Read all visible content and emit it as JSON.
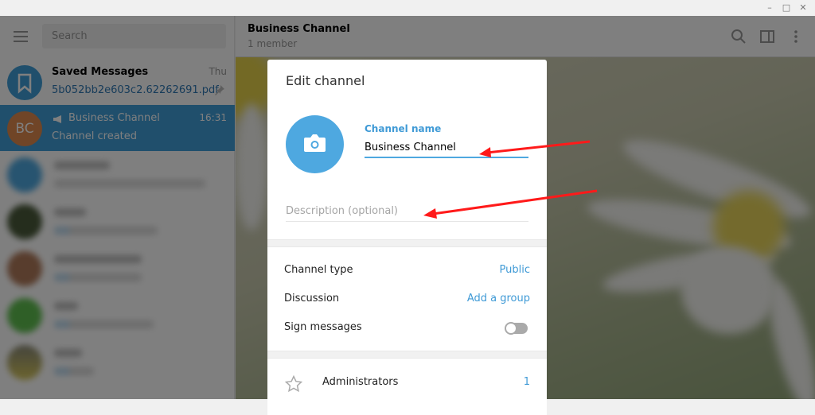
{
  "window": {
    "minimize": "–",
    "maximize": "□",
    "close": "✕"
  },
  "sidebar": {
    "search_placeholder": "Search",
    "chats": [
      {
        "name": "Saved Messages",
        "time": "Thu",
        "preview": "5b052bb2e603c2.62262691.pdf",
        "icon": "bookmark-icon",
        "pinned": true,
        "avatar_color": "#419fd9"
      },
      {
        "name": "Business Channel",
        "time": "16:31",
        "preview": "Channel created",
        "avatar_initials": "BC",
        "icon": "megaphone-icon",
        "avatar_color": "#e08a4e",
        "active": true
      }
    ]
  },
  "chat_header": {
    "title": "Business Channel",
    "subtitle": "1 member"
  },
  "dialog": {
    "title": "Edit channel",
    "channel_name_label": "Channel name",
    "channel_name_value": "Business Channel",
    "description_placeholder": "Description (optional)",
    "rows": [
      {
        "label": "Channel type",
        "value": "Public"
      },
      {
        "label": "Discussion",
        "value": "Add a group"
      },
      {
        "label": "Sign messages",
        "toggle": false
      }
    ],
    "administrators": {
      "label": "Administrators",
      "count": "1"
    }
  },
  "colors": {
    "accent": "#419fd9",
    "annotation_arrow": "#ff0000"
  }
}
